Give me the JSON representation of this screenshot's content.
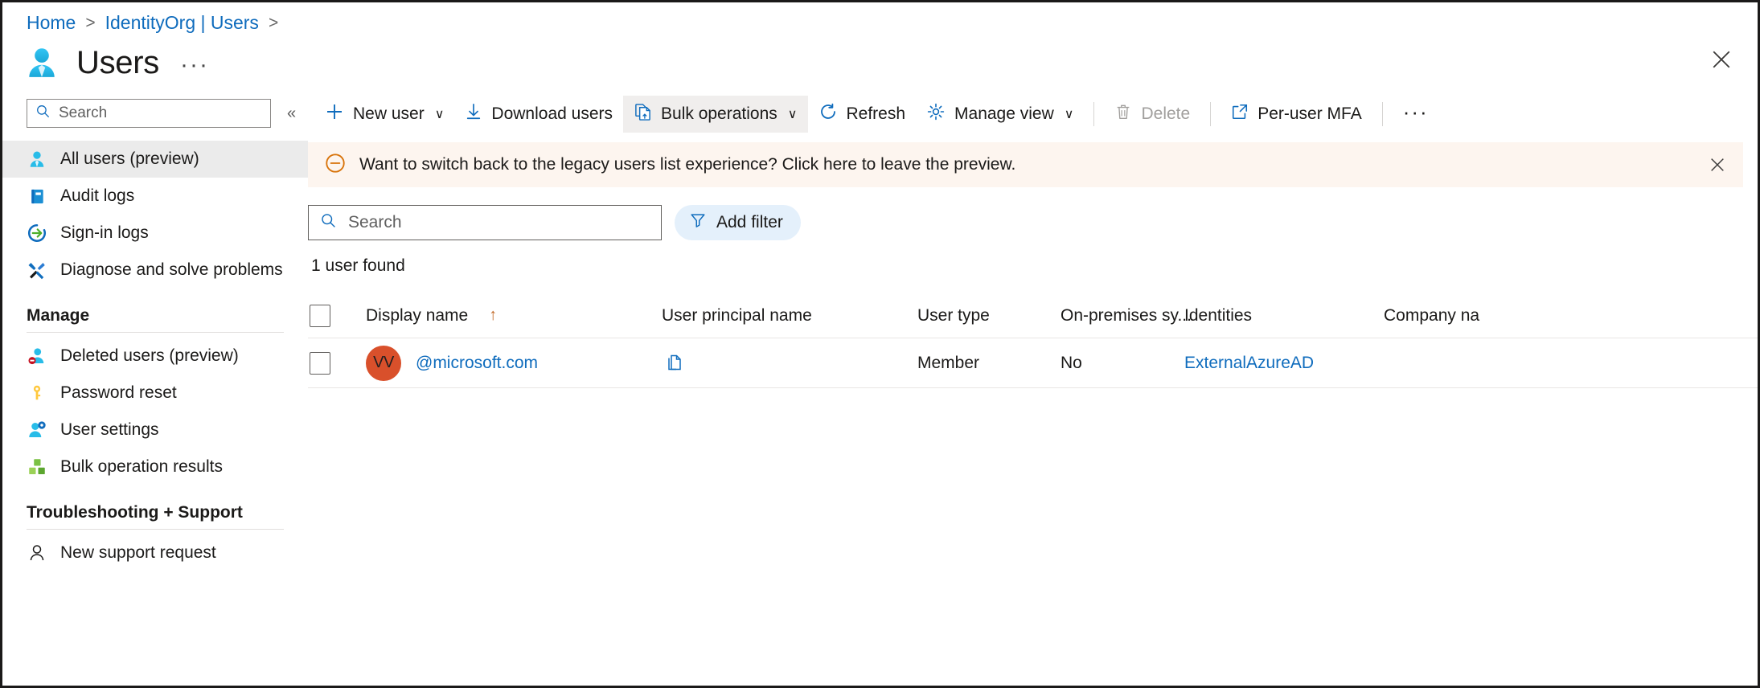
{
  "window": {
    "close_icon": "close-icon"
  },
  "breadcrumb": {
    "items": [
      {
        "label": "Home",
        "sep": ">"
      },
      {
        "label": "IdentityOrg | Users",
        "sep": ">"
      }
    ]
  },
  "header": {
    "icon": "user-icon",
    "title": "Users",
    "ellipsis": "···"
  },
  "sidebar": {
    "search": {
      "placeholder": "Search",
      "value": "",
      "icon": "search-icon"
    },
    "collapse_icon": "«",
    "items": [
      {
        "label": "All users (preview)",
        "icon": "user-icon",
        "active": true
      },
      {
        "label": "Audit logs",
        "icon": "book-icon",
        "active": false
      },
      {
        "label": "Sign-in logs",
        "icon": "sign-in-icon",
        "active": false
      },
      {
        "label": "Diagnose and solve problems",
        "icon": "wrench-icon",
        "active": false
      }
    ],
    "groups": [
      {
        "title": "Manage",
        "items": [
          {
            "label": "Deleted users (preview)",
            "icon": "deleted-user-icon"
          },
          {
            "label": "Password reset",
            "icon": "key-icon"
          },
          {
            "label": "User settings",
            "icon": "user-settings-icon"
          },
          {
            "label": "Bulk operation results",
            "icon": "bulk-results-icon"
          }
        ]
      },
      {
        "title": "Troubleshooting + Support",
        "items": [
          {
            "label": "New support request",
            "icon": "support-person-icon"
          }
        ]
      }
    ]
  },
  "toolbar": {
    "new_user": {
      "label": "New user",
      "icon": "plus-icon",
      "caret": "∨"
    },
    "download_users": {
      "label": "Download users",
      "icon": "download-icon"
    },
    "bulk_operations": {
      "label": "Bulk operations",
      "icon": "bulk-upload-icon",
      "caret": "∨",
      "highlighted": true
    },
    "refresh": {
      "label": "Refresh",
      "icon": "refresh-icon"
    },
    "manage_view": {
      "label": "Manage view",
      "icon": "gear-icon",
      "caret": "∨"
    },
    "delete": {
      "label": "Delete",
      "icon": "trash-icon",
      "disabled": true
    },
    "per_user_mfa": {
      "label": "Per-user MFA",
      "icon": "external-link-icon"
    },
    "overflow": {
      "label": "···",
      "icon": "more-icon"
    }
  },
  "banner": {
    "icon": "circle-minus-icon",
    "text": "Want to switch back to the legacy users list experience? Click here to leave the preview.",
    "close_icon": "close-icon",
    "background": "#fdf5ef",
    "accent": "#d8730a"
  },
  "filters": {
    "search": {
      "placeholder": "Search",
      "value": "",
      "icon": "search-icon"
    },
    "add_filter": {
      "label": "Add filter",
      "icon": "filter-icon"
    }
  },
  "results": {
    "count_text": "1 user found"
  },
  "table": {
    "select_all_checkbox": "",
    "columns": [
      {
        "key": "display_name",
        "label": "Display name",
        "sorted": true,
        "sort_arrow": "↑"
      },
      {
        "key": "user_principal_name",
        "label": "User principal name",
        "sorted": false
      },
      {
        "key": "user_type",
        "label": "User type",
        "sorted": false
      },
      {
        "key": "on_premises_sync",
        "label": "On-premises sy...",
        "sorted": false
      },
      {
        "key": "identities",
        "label": "Identities",
        "sorted": false
      },
      {
        "key": "company_name",
        "label": "Company na",
        "sorted": false
      }
    ],
    "rows": [
      {
        "avatar_initials": "VV",
        "avatar_color": "#d9502b",
        "display_name": "",
        "user_principal_name": "@microsoft.com",
        "upn_copy_icon": "copy-icon",
        "user_type": "Member",
        "on_premises_sync": "No",
        "identities": "ExternalAzureAD",
        "company_name": ""
      }
    ]
  },
  "colors": {
    "link": "#0f6cbd",
    "accent_orange": "#d8730a",
    "avatar": "#d9502b",
    "highlight": "#ebebeb",
    "filter_pill": "#e4f0fb"
  }
}
